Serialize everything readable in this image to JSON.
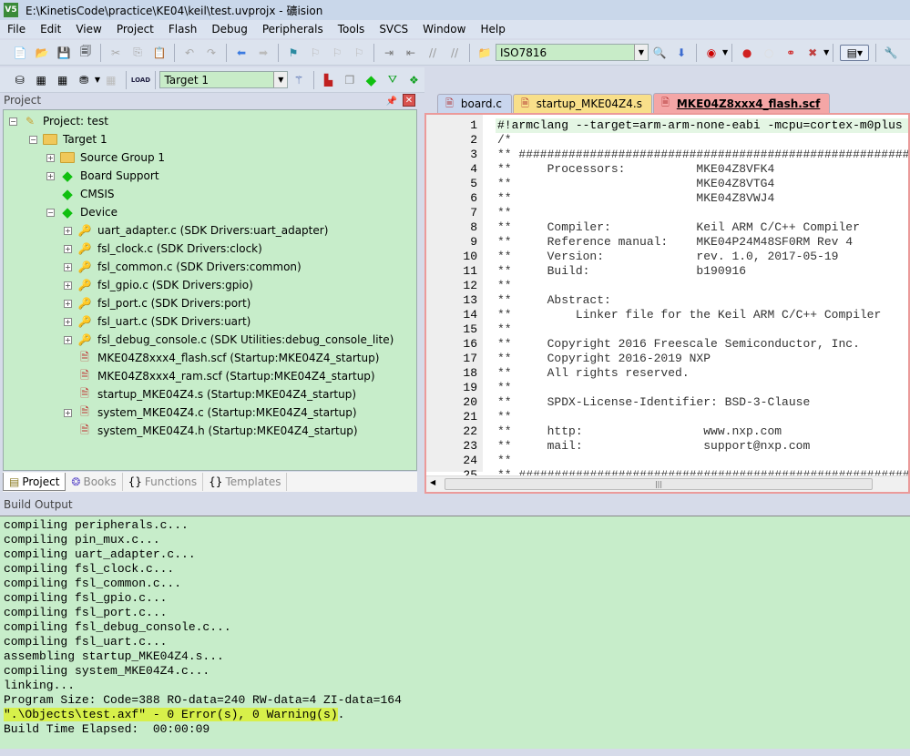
{
  "window": {
    "title": "E:\\KinetisCode\\practice\\KE04\\keil\\test.uvprojx - 礦ision"
  },
  "menu": [
    "File",
    "Edit",
    "View",
    "Project",
    "Flash",
    "Debug",
    "Peripherals",
    "Tools",
    "SVCS",
    "Window",
    "Help"
  ],
  "toolbar": {
    "find_combo": "ISO7816",
    "target_combo": "Target 1"
  },
  "project_panel": {
    "title": "Project",
    "tree": [
      {
        "label": "Project: test",
        "level": 0,
        "expander": "minus",
        "icon": "project-icon"
      },
      {
        "label": "Target 1",
        "level": 1,
        "expander": "minus",
        "icon": "target-folder-icon"
      },
      {
        "label": "Source Group 1",
        "level": 2,
        "expander": "plus",
        "icon": "folder-icon"
      },
      {
        "label": "Board Support",
        "level": 2,
        "expander": "plus",
        "icon": "component-icon"
      },
      {
        "label": "CMSIS",
        "level": 2,
        "expander": "none",
        "icon": "component-icon"
      },
      {
        "label": "Device",
        "level": 2,
        "expander": "minus",
        "icon": "component-icon"
      },
      {
        "label": "uart_adapter.c (SDK Drivers:uart_adapter)",
        "level": 3,
        "expander": "plus",
        "icon": "key-file-icon"
      },
      {
        "label": "fsl_clock.c (SDK Drivers:clock)",
        "level": 3,
        "expander": "plus",
        "icon": "key-file-icon"
      },
      {
        "label": "fsl_common.c (SDK Drivers:common)",
        "level": 3,
        "expander": "plus",
        "icon": "key-file-icon"
      },
      {
        "label": "fsl_gpio.c (SDK Drivers:gpio)",
        "level": 3,
        "expander": "plus",
        "icon": "key-file-icon"
      },
      {
        "label": "fsl_port.c (SDK Drivers:port)",
        "level": 3,
        "expander": "plus",
        "icon": "key-file-icon"
      },
      {
        "label": "fsl_uart.c (SDK Drivers:uart)",
        "level": 3,
        "expander": "plus",
        "icon": "key-file-icon"
      },
      {
        "label": "fsl_debug_console.c (SDK Utilities:debug_console_lite)",
        "level": 3,
        "expander": "plus",
        "icon": "key-file-icon"
      },
      {
        "label": "MKE04Z8xxx4_flash.scf (Startup:MKE04Z4_startup)",
        "level": 3,
        "expander": "none",
        "icon": "locked-file-icon"
      },
      {
        "label": "MKE04Z8xxx4_ram.scf (Startup:MKE04Z4_startup)",
        "level": 3,
        "expander": "none",
        "icon": "locked-file-icon"
      },
      {
        "label": "startup_MKE04Z4.s (Startup:MKE04Z4_startup)",
        "level": 3,
        "expander": "none",
        "icon": "locked-file-icon"
      },
      {
        "label": "system_MKE04Z4.c (Startup:MKE04Z4_startup)",
        "level": 3,
        "expander": "plus",
        "icon": "locked-file-icon"
      },
      {
        "label": "system_MKE04Z4.h (Startup:MKE04Z4_startup)",
        "level": 3,
        "expander": "none",
        "icon": "locked-file-icon"
      }
    ],
    "tabs": [
      "Project",
      "Books",
      "Functions",
      "Templates"
    ]
  },
  "editor": {
    "tabs": [
      {
        "label": "board.c",
        "color": "#c9d6ee"
      },
      {
        "label": "startup_MKE04Z4.s",
        "color": "#f8df8a"
      },
      {
        "label": "MKE04Z8xxx4_flash.scf",
        "color": "#f4a6a6",
        "active": true
      }
    ],
    "lines": [
      "#!armclang --target=arm-arm-none-eabi -mcpu=cortex-m0plus",
      "/*",
      "** ###################################################################",
      "**     Processors:          MKE04Z8VFK4",
      "**                          MKE04Z8VTG4",
      "**                          MKE04Z8VWJ4",
      "**",
      "**     Compiler:            Keil ARM C/C++ Compiler",
      "**     Reference manual:    MKE04P24M48SF0RM Rev 4",
      "**     Version:             rev. 1.0, 2017-05-19",
      "**     Build:               b190916",
      "**",
      "**     Abstract:",
      "**         Linker file for the Keil ARM C/C++ Compiler",
      "**",
      "**     Copyright 2016 Freescale Semiconductor, Inc.",
      "**     Copyright 2016-2019 NXP",
      "**     All rights reserved.",
      "**",
      "**     SPDX-License-Identifier: BSD-3-Clause",
      "**",
      "**     http:                 www.nxp.com",
      "**     mail:                 support@nxp.com",
      "**",
      "** ###################################################################"
    ]
  },
  "build_output": {
    "title": "Build Output",
    "lines": [
      "compiling peripherals.c...",
      "compiling pin_mux.c...",
      "compiling uart_adapter.c...",
      "compiling fsl_clock.c...",
      "compiling fsl_common.c...",
      "compiling fsl_gpio.c...",
      "compiling fsl_port.c...",
      "compiling fsl_debug_console.c...",
      "compiling fsl_uart.c...",
      "assembling startup_MKE04Z4.s...",
      "compiling system_MKE04Z4.c...",
      "linking...",
      "Program Size: Code=388 RO-data=240 RW-data=4 ZI-data=164"
    ],
    "result_highlighted": "\".\\Objects\\test.axf\" - 0 Error(s), 0 Warning(s)",
    "result_tail": ".",
    "elapsed": "Build Time Elapsed:  00:00:09",
    "highlight_color": "#d7f04a"
  }
}
